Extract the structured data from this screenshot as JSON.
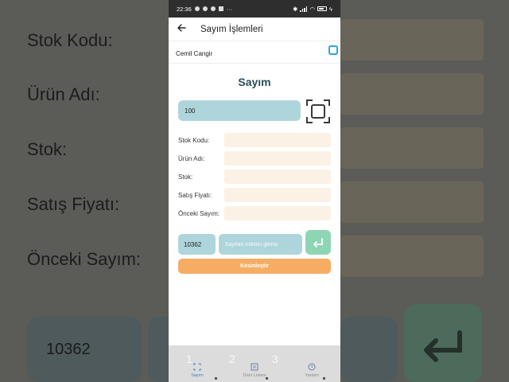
{
  "status_bar": {
    "time": "22:36",
    "more": "···"
  },
  "app_bar": {
    "back_icon": "arrow-left-icon",
    "title": "Sayım İşlemleri"
  },
  "user": {
    "name": "Cemil Cangir"
  },
  "section": {
    "title": "Sayım"
  },
  "scan": {
    "value": "100",
    "icon": "scan-frame-icon"
  },
  "form": {
    "fields": [
      {
        "label": "Stok Kodu:",
        "value": ""
      },
      {
        "label": "Ürün Adı:",
        "value": ""
      },
      {
        "label": "Stok:",
        "value": ""
      },
      {
        "label": "Satış Fiyatı:",
        "value": ""
      },
      {
        "label": "Önceki Sayım:",
        "value": ""
      }
    ]
  },
  "entry": {
    "barcode": "10362",
    "amount_placeholder": "Sayılan miktarı giriniz",
    "enter_icon": "enter-return-icon",
    "confirm_label": "Kesinleştir"
  },
  "keypad": {
    "keys": [
      "1",
      "2",
      "3"
    ]
  },
  "bottom_nav": {
    "items": [
      {
        "label": "Sayım",
        "icon": "scan-frame-icon"
      },
      {
        "label": "Ürün Listesi",
        "icon": "list-icon"
      },
      {
        "label": "Yardım",
        "icon": "help-icon"
      }
    ]
  },
  "colors": {
    "accent_teal": "#aed5dc",
    "confirm_orange": "#f6ad63",
    "enter_green": "#8ed6b3",
    "field_cream": "#fbf1e4",
    "title_color": "#2c4e5b",
    "nav_active": "#3b82c4"
  }
}
